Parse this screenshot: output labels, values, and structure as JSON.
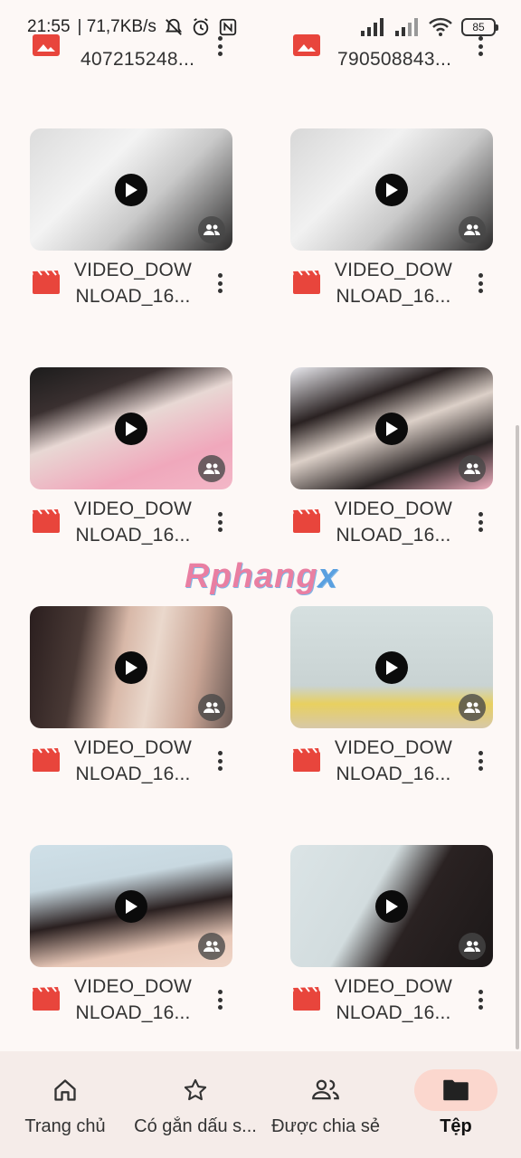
{
  "status_bar": {
    "time": "21:55",
    "network_speed": "| 71,7KB/s",
    "battery_level": "85"
  },
  "top_row": [
    {
      "name": "407215248..."
    },
    {
      "name": "790508843..."
    }
  ],
  "files": [
    {
      "name_line1": "VIDEO_DOW",
      "name_line2": "NLOAD_16...",
      "type": "video",
      "shared": true
    },
    {
      "name_line1": "VIDEO_DOW",
      "name_line2": "NLOAD_16...",
      "type": "video",
      "shared": true
    },
    {
      "name_line1": "VIDEO_DOW",
      "name_line2": "NLOAD_16...",
      "type": "video",
      "shared": true
    },
    {
      "name_line1": "VIDEO_DOW",
      "name_line2": "NLOAD_16...",
      "type": "video",
      "shared": true
    },
    {
      "name_line1": "VIDEO_DOW",
      "name_line2": "NLOAD_16...",
      "type": "video",
      "shared": true
    },
    {
      "name_line1": "VIDEO_DOW",
      "name_line2": "NLOAD_16...",
      "type": "video",
      "shared": true
    },
    {
      "name_line1": "VIDEO_DOW",
      "name_line2": "NLOAD_16...",
      "type": "video",
      "shared": true
    },
    {
      "name_line1": "VIDEO_DOW",
      "name_line2": "NLOAD_16...",
      "type": "video",
      "shared": true
    }
  ],
  "watermark": {
    "part1": "Rphang",
    "part2": "x"
  },
  "bottom_nav": {
    "items": [
      {
        "label": "Trang chủ",
        "icon": "home-icon",
        "active": false
      },
      {
        "label": "Có gắn dấu s...",
        "icon": "star-icon",
        "active": false
      },
      {
        "label": "Được chia sẻ",
        "icon": "people-icon",
        "active": false
      },
      {
        "label": "Tệp",
        "icon": "folder-icon",
        "active": true
      }
    ]
  },
  "colors": {
    "accent": "#fbd7ce",
    "video_icon": "#e8453c",
    "background": "#fdf8f6",
    "nav_background": "#f5ece9"
  }
}
